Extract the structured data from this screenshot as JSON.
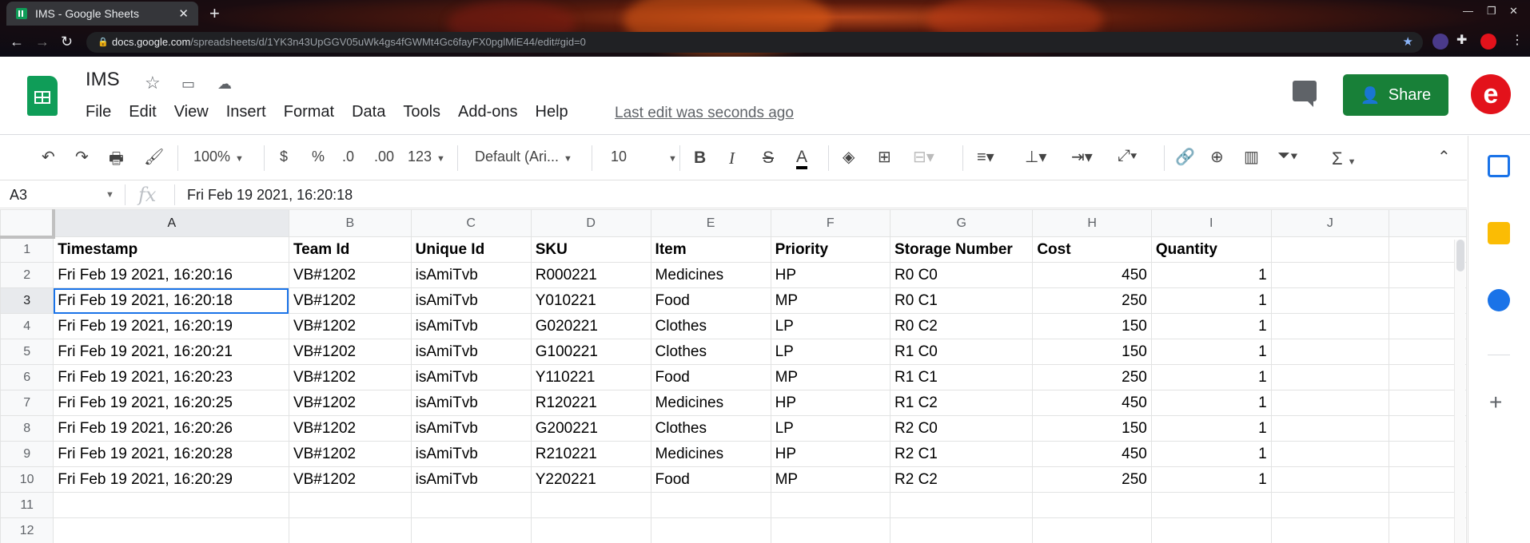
{
  "browser": {
    "tab_title": "IMS - Google Sheets",
    "url_host": "docs.google.com",
    "url_path": "/spreadsheets/d/1YK3n43UpGGV05uWk4gs4fGWMt4Gc6fayFX0pglMiE44/edit#gid=0"
  },
  "doc": {
    "title": "IMS",
    "menus": [
      "File",
      "Edit",
      "View",
      "Insert",
      "Format",
      "Data",
      "Tools",
      "Add-ons",
      "Help"
    ],
    "last_edit": "Last edit was seconds ago",
    "share_label": "Share",
    "avatar_letter": "e"
  },
  "toolbar": {
    "zoom": "100%",
    "currency": "$",
    "percent": "%",
    "dec_decrease": ".0",
    "dec_increase": ".00",
    "more_formats": "123",
    "font": "Default (Ari...",
    "font_size": "10",
    "bold": "B",
    "italic": "I",
    "strike": "S",
    "text_color": "A",
    "sum": "Σ"
  },
  "formula_bar": {
    "cell_ref": "A3",
    "fx": "fx",
    "value": "Fri Feb 19 2021, 16:20:18"
  },
  "sheet": {
    "col_letters": [
      "A",
      "B",
      "C",
      "D",
      "E",
      "F",
      "G",
      "H",
      "I",
      "J"
    ],
    "row_numbers": [
      "1",
      "2",
      "3",
      "4",
      "5",
      "6",
      "7",
      "8",
      "9",
      "10",
      "11",
      "12"
    ],
    "header": [
      "Timestamp",
      "Team Id",
      "Unique Id",
      "SKU",
      "Item",
      "Priority",
      "Storage Number",
      "Cost",
      "Quantity",
      ""
    ],
    "rows": [
      [
        "Fri Feb 19 2021, 16:20:16",
        "VB#1202",
        "isAmiTvb",
        "R000221",
        "Medicines",
        "HP",
        "R0 C0",
        "450",
        "1",
        ""
      ],
      [
        "Fri Feb 19 2021, 16:20:18",
        "VB#1202",
        "isAmiTvb",
        "Y010221",
        "Food",
        "MP",
        "R0 C1",
        "250",
        "1",
        ""
      ],
      [
        "Fri Feb 19 2021, 16:20:19",
        "VB#1202",
        "isAmiTvb",
        "G020221",
        "Clothes",
        "LP",
        "R0 C2",
        "150",
        "1",
        ""
      ],
      [
        "Fri Feb 19 2021, 16:20:21",
        "VB#1202",
        "isAmiTvb",
        "G100221",
        "Clothes",
        "LP",
        "R1 C0",
        "150",
        "1",
        ""
      ],
      [
        "Fri Feb 19 2021, 16:20:23",
        "VB#1202",
        "isAmiTvb",
        "Y110221",
        "Food",
        "MP",
        "R1 C1",
        "250",
        "1",
        ""
      ],
      [
        "Fri Feb 19 2021, 16:20:25",
        "VB#1202",
        "isAmiTvb",
        "R120221",
        "Medicines",
        "HP",
        "R1 C2",
        "450",
        "1",
        ""
      ],
      [
        "Fri Feb 19 2021, 16:20:26",
        "VB#1202",
        "isAmiTvb",
        "G200221",
        "Clothes",
        "LP",
        "R2 C0",
        "150",
        "1",
        ""
      ],
      [
        "Fri Feb 19 2021, 16:20:28",
        "VB#1202",
        "isAmiTvb",
        "R210221",
        "Medicines",
        "HP",
        "R2 C1",
        "450",
        "1",
        ""
      ],
      [
        "Fri Feb 19 2021, 16:20:29",
        "VB#1202",
        "isAmiTvb",
        "Y220221",
        "Food",
        "MP",
        "R2 C2",
        "250",
        "1",
        ""
      ],
      [
        "",
        "",
        "",
        "",
        "",
        "",
        "",
        "",
        "",
        ""
      ],
      [
        "",
        "",
        "",
        "",
        "",
        "",
        "",
        "",
        "",
        ""
      ]
    ],
    "selected_row": 3,
    "selected_col": "A"
  },
  "colors": {
    "share_green": "#188038",
    "sheets_green": "#0f9d58",
    "selection_blue": "#1a73e8",
    "avatar_red": "#e3121b"
  }
}
